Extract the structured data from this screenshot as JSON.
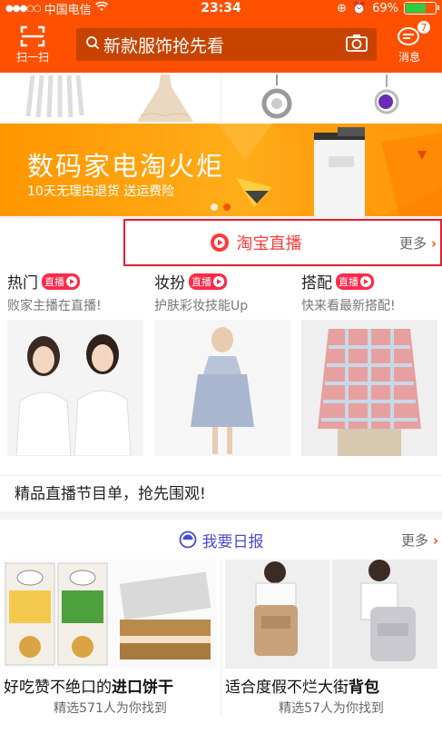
{
  "status": {
    "carrier": "中国电信",
    "time": "23:34",
    "battery": "69%",
    "battery_level": 0.69
  },
  "header": {
    "scan_label": "扫一扫",
    "search_placeholder": "新款服饰抢先看",
    "message_label": "消息",
    "message_count": "7"
  },
  "banner": {
    "title": "数码家电淘火炬",
    "subtitle": "10天无理由退货 送运费险"
  },
  "live": {
    "title": "淘宝直播",
    "more": "更多",
    "tag": "直播",
    "columns": [
      {
        "title": "热门",
        "subtitle": "败家主播在直播!"
      },
      {
        "title": "妆扮",
        "subtitle": "护肤彩妆技能Up"
      },
      {
        "title": "搭配",
        "subtitle": "快来看最新搭配!"
      }
    ],
    "footer": "精品直播节目单，抢先围观!"
  },
  "daily": {
    "title": "我要日报",
    "more": "更多",
    "cards": [
      {
        "name_plain": "好吃赞不绝口的",
        "name_bold": "进口饼干",
        "subtitle": "精选571人为你找到"
      },
      {
        "name_plain": "适合度假不烂大街",
        "name_bold": "背包",
        "subtitle": "精选57人为你找到"
      }
    ]
  },
  "colors": {
    "brand": "#ff5000",
    "live_red": "#ff3a3a",
    "daily_blue": "#4a4ad6"
  }
}
